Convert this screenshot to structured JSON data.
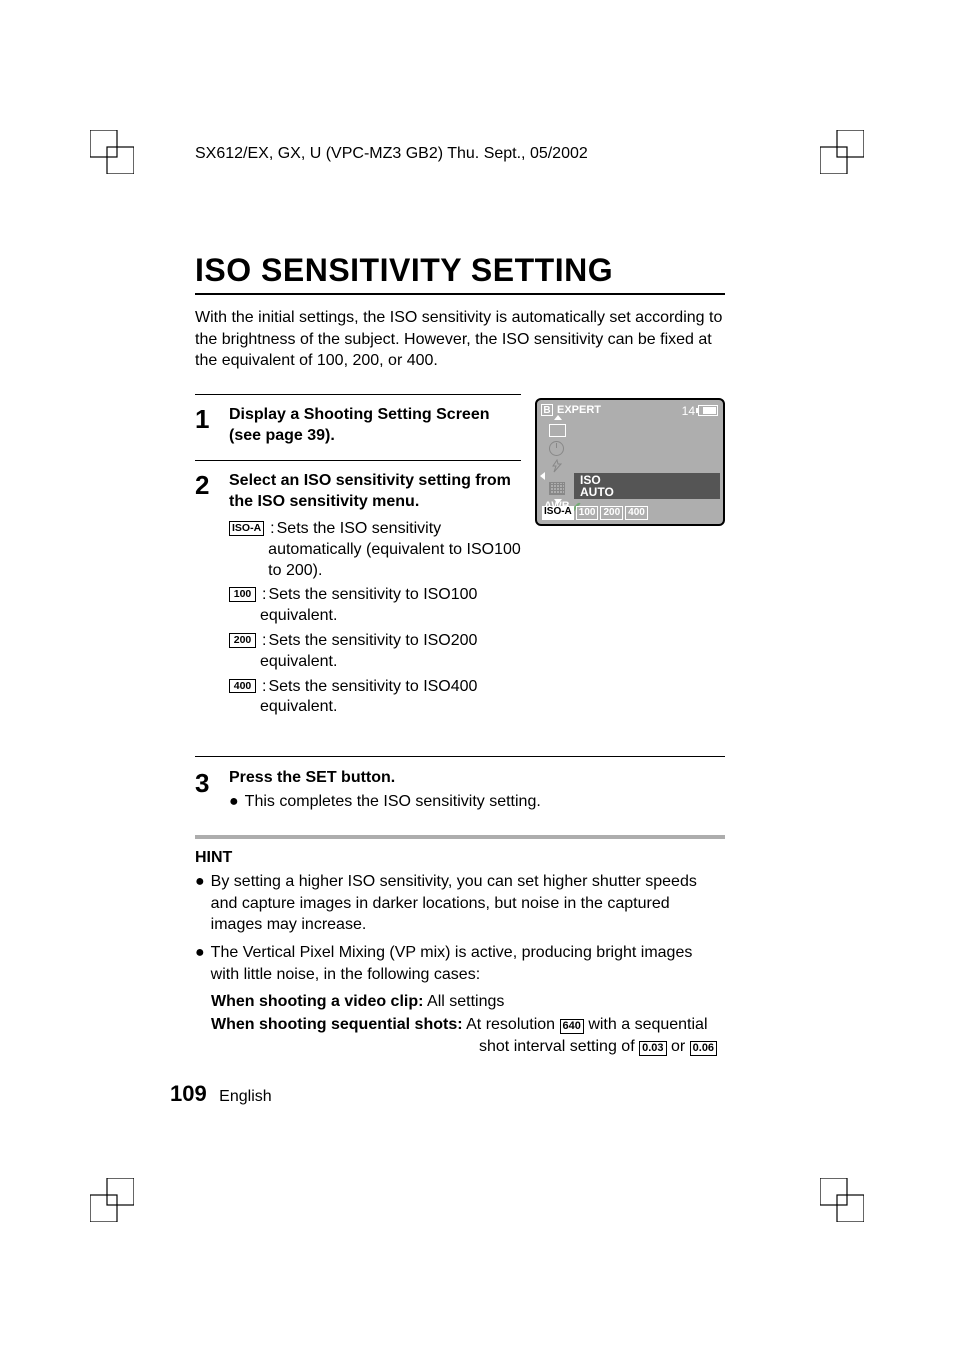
{
  "header": "SX612/EX, GX, U (VPC-MZ3 GB2)    Thu. Sept., 05/2002",
  "title": "ISO SENSITIVITY SETTING",
  "intro": "With the initial settings, the ISO sensitivity is automatically set according to the brightness of the subject. However, the ISO sensitivity can be fixed at the equivalent of 100, 200, or 400.",
  "step1": {
    "num": "1",
    "head": "Display a Shooting Setting Screen (see page 39)."
  },
  "step2": {
    "num": "2",
    "head": "Select an ISO sensitivity setting from the ISO sensitivity menu.",
    "options": [
      {
        "box": "ISO-A",
        "text": "Sets the ISO sensitivity automatically (equivalent to ISO100 to 200)."
      },
      {
        "box": "100",
        "text": "Sets the sensitivity to ISO100 equivalent."
      },
      {
        "box": "200",
        "text": "Sets the sensitivity to ISO200 equivalent."
      },
      {
        "box": "400",
        "text": "Sets the sensitivity to ISO400 equivalent."
      }
    ]
  },
  "screen": {
    "b": "B",
    "expert": "EXPERT",
    "count": "14",
    "awb": "AWB",
    "iso_line1": "ISO",
    "iso_line2": "AUTO",
    "bottom": [
      "ISO-A",
      "100",
      "200",
      "400"
    ]
  },
  "step3": {
    "num": "3",
    "head": "Press the SET button.",
    "bullet": "This completes the ISO sensitivity setting."
  },
  "hint": {
    "title": "HINT",
    "b1": "By setting a higher ISO sensitivity, you can set higher shutter speeds and capture images in darker locations, but noise in the captured images may increase.",
    "b2": "The Vertical Pixel Mixing (VP mix) is active, producing bright images with little noise, in the following cases:",
    "s1a": "When shooting a video clip:",
    "s1b": "All settings",
    "s2a": "When shooting sequential shots:",
    "s2b_pre": "At resolution ",
    "s2b_box1": "640",
    "s2b_mid": " with a sequential",
    "s2c_pre": "shot interval setting of ",
    "s2c_box1": "0.03",
    "s2c_mid": " or ",
    "s2c_box2": "0.06"
  },
  "footer": {
    "page": "109",
    "lang": "English"
  }
}
